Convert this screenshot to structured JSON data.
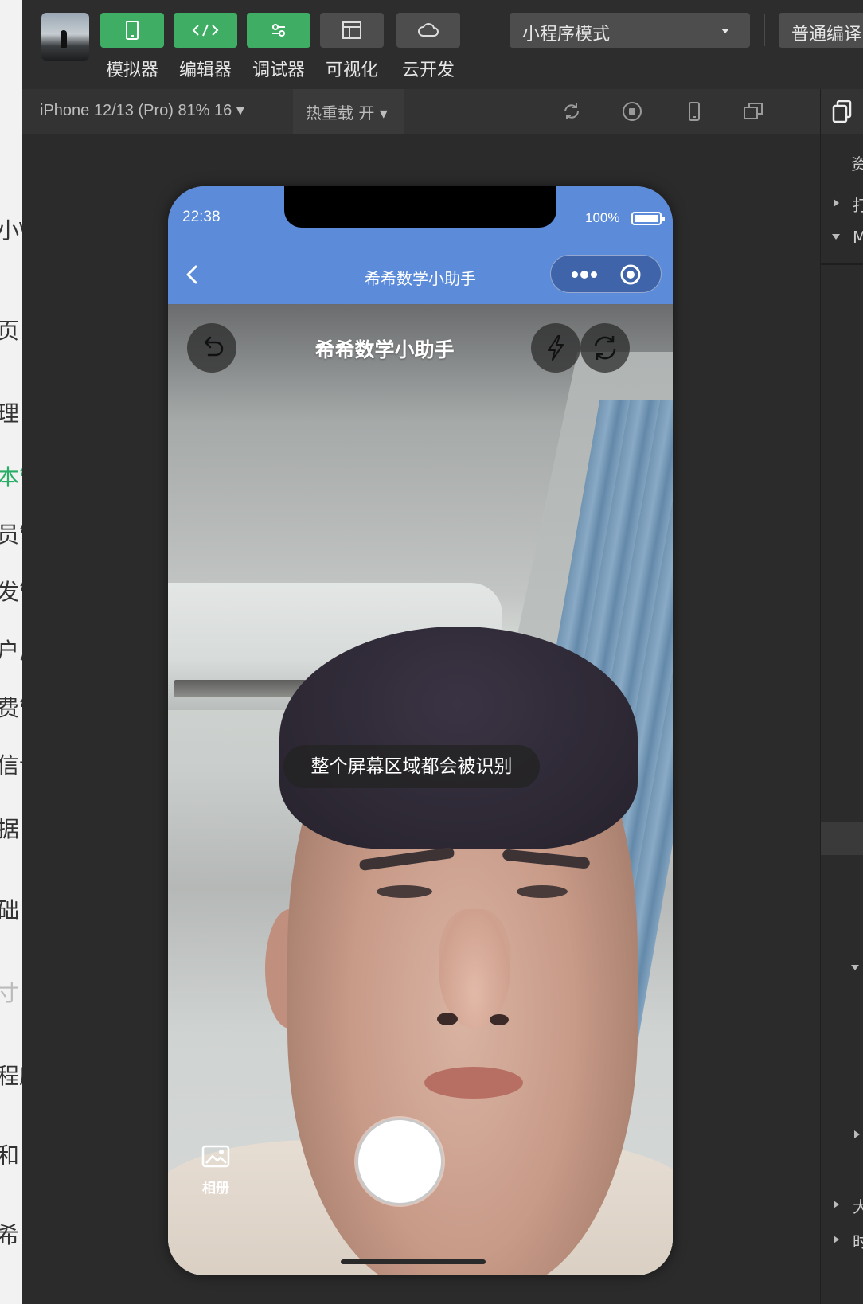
{
  "left_strip": {
    "items": [
      "小\\",
      "页",
      "理",
      "本管",
      "员管",
      "发管",
      "户反",
      "费管",
      "信认",
      "据",
      "础",
      "寸",
      "程序",
      "和",
      "希"
    ]
  },
  "toolbar": {
    "tools": [
      {
        "label": "模拟器",
        "icon": "phone-icon",
        "color": "green"
      },
      {
        "label": "编辑器",
        "icon": "code-icon",
        "color": "green"
      },
      {
        "label": "调试器",
        "icon": "debug-sliders-icon",
        "color": "green"
      },
      {
        "label": "可视化",
        "icon": "layout-icon",
        "color": "gray"
      },
      {
        "label": "云开发",
        "icon": "cloud-icon",
        "color": "gray"
      }
    ],
    "mode_select": "小程序模式",
    "compile_select": "普通编译"
  },
  "simulator_bar": {
    "device": "iPhone 12/13 (Pro) 81% 16 ▾",
    "hot_reload": "热重载 开 ▾",
    "icons": [
      "refresh-icon",
      "stop-record-icon",
      "phone-outline-icon",
      "detach-window-icon"
    ]
  },
  "right_panel": {
    "labels": [
      "资",
      "打",
      "M",
      "大",
      "时"
    ]
  },
  "phone": {
    "status": {
      "time": "22:38",
      "battery": "100%"
    },
    "nav": {
      "title": "希希数学小助手"
    },
    "camera": {
      "title": "希希数学小助手",
      "hint": "整个屏幕区域都会被识别",
      "album_label": "相册"
    }
  },
  "colors": {
    "accent_green": "#3fae64",
    "nav_blue": "#5b8bd9",
    "dark_bg": "#2b2b2b"
  }
}
